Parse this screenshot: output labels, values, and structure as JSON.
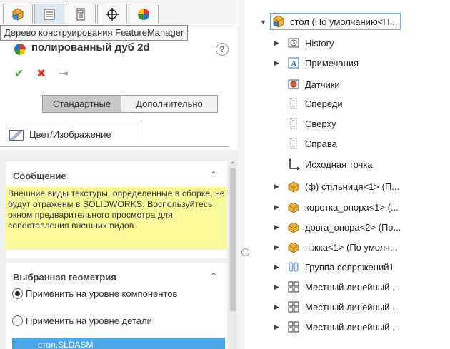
{
  "property_manager": {
    "tooltip": "Дерево конструирования FeatureManager",
    "title": "полированный дуб 2d",
    "help_icon": "?",
    "ok_icon": "✔",
    "cancel_icon": "✖",
    "pin_icon": "⊸",
    "mode_tabs": {
      "standard": "Стандартные",
      "advanced": "Дополнительно"
    },
    "color_tab": "Цвет/Изображение",
    "message_section": {
      "title": "Сообщение",
      "text": "Внешние виды текстуры, определенные в сборке, не будут отражены в SOLIDWORKS. Воспользуйтесь окном предварительного просмотра для сопоставления внешних видов."
    },
    "selection_section": {
      "title": "Выбранная геометрия",
      "option_component": "Применить на уровне компонентов",
      "option_part": "Применить на уровне детали",
      "selected_item": "стол.SLDASM"
    },
    "top_tabs": [
      "feature-manager-tab",
      "property-manager-tab",
      "configuration-manager-tab",
      "dimxpert-tab",
      "display-manager-tab"
    ]
  },
  "feature_tree": {
    "root": "стол  (По умолчанию<П...",
    "items": [
      {
        "label": "History",
        "icon": "history-icon",
        "expandable": true
      },
      {
        "label": "Примечания",
        "icon": "annotations-icon",
        "expandable": true
      },
      {
        "label": "Датчики",
        "icon": "sensors-icon",
        "expandable": false
      },
      {
        "label": "Спереди",
        "icon": "plane-icon",
        "expandable": false
      },
      {
        "label": "Сверху",
        "icon": "plane-icon",
        "expandable": false
      },
      {
        "label": "Справа",
        "icon": "plane-icon",
        "expandable": false
      },
      {
        "label": "Исходная точка",
        "icon": "origin-icon",
        "expandable": false
      },
      {
        "label": "(ф) стільниця<1> (П...",
        "icon": "part-icon",
        "expandable": true
      },
      {
        "label": "коротка_опора<1> (...",
        "icon": "part-icon",
        "expandable": true
      },
      {
        "label": "довга_опора<2> (По...",
        "icon": "part-icon",
        "expandable": true
      },
      {
        "label": "ніжка<1> (По умолч...",
        "icon": "part-icon",
        "expandable": true
      },
      {
        "label": "Группа сопряжений1",
        "icon": "mates-icon",
        "expandable": true
      },
      {
        "label": "Местный линейный ...",
        "icon": "pattern-icon",
        "expandable": true
      },
      {
        "label": "Местный линейный ...",
        "icon": "pattern-icon",
        "expandable": true
      },
      {
        "label": "Местный линейный ...",
        "icon": "pattern-icon",
        "expandable": true
      }
    ]
  },
  "colors": {
    "message_bg": "#fafa9b",
    "selection_bg": "#4ea5e3",
    "ok": "#4ba83d",
    "cancel": "#d13a2c"
  }
}
